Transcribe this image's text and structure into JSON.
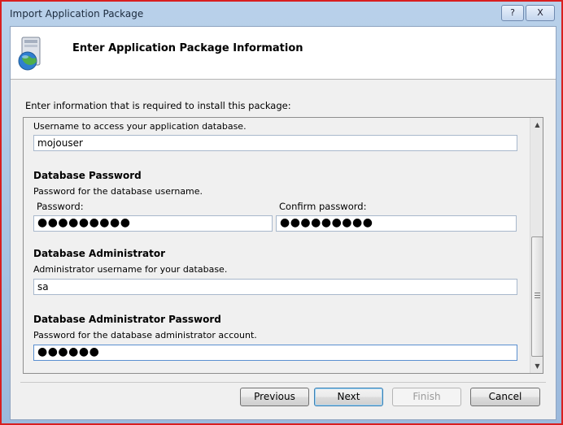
{
  "window": {
    "title": "Import Application Package",
    "help_label": "?",
    "close_label": "X"
  },
  "header": {
    "title": "Enter Application Package Information"
  },
  "instruction": "Enter information that is required to install this package:",
  "fields": {
    "username": {
      "description": "Username to access your application database.",
      "value": "mojouser"
    },
    "db_password": {
      "label": "Database Password",
      "description": "Password for the database username.",
      "password_label": "Password:",
      "confirm_label": "Confirm password:",
      "password_mask": "●●●●●●●●●",
      "confirm_mask": "●●●●●●●●●"
    },
    "db_admin": {
      "label": "Database Administrator",
      "description": "Administrator username for your database.",
      "value": "sa"
    },
    "db_admin_password": {
      "label": "Database Administrator Password",
      "description": "Password for the database administrator account.",
      "password_mask": "●●●●●●"
    }
  },
  "buttons": {
    "previous": "Previous",
    "next": "Next",
    "finish": "Finish",
    "cancel": "Cancel"
  },
  "icons": {
    "package": "package-globe-icon",
    "scroll_up": "scroll-up-arrow-icon",
    "scroll_down": "scroll-down-arrow-icon"
  }
}
